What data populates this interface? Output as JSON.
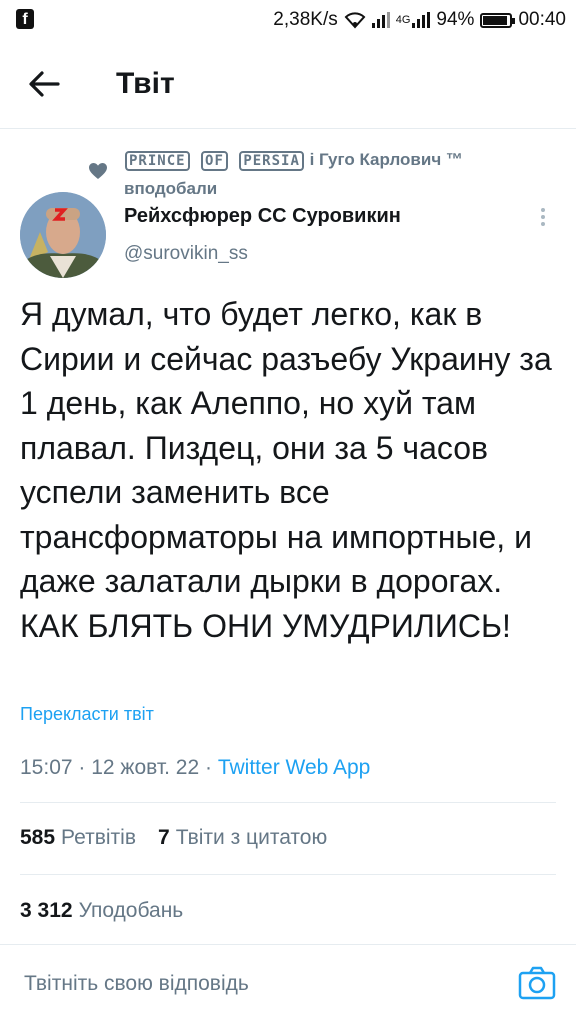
{
  "status_bar": {
    "network_speed": "2,38K/s",
    "network_type": "4G",
    "battery_percent": "94%",
    "battery_level": 0.94,
    "time": "00:40",
    "icons": [
      "facebook-icon",
      "wifi-icon",
      "signal-icon",
      "battery-icon"
    ]
  },
  "header": {
    "title": "Твіт",
    "back_icon": "arrow-left-icon"
  },
  "liked_context": {
    "name1_boxed_words": [
      "PRINCE",
      "OF",
      "PERSIA"
    ],
    "text_rest": " і Гуго Карлович ™ вподобали",
    "icon": "heart-icon"
  },
  "author": {
    "name": "Рейхсфюрер СС Суровикин",
    "handle": "@surovikin_ss"
  },
  "tweet": {
    "text": "Я думал, что будет легко, как в Сирии и сейчас разъебу Украину за 1 день, как Алеппо, но хуй там плавал. Пиздец, они за 5 часов успели заменить все трансформаторы на импортные, и даже залатали дырки в дорогах. КАК БЛЯТЬ ОНИ УМУДРИЛИСЬ!",
    "translate_label": "Перекласти твіт",
    "time": "15:07",
    "date": "12 жовт. 22",
    "source": "Twitter Web App",
    "sep": " · "
  },
  "stats": {
    "retweets_count": "585",
    "retweets_label": "Ретвітів",
    "quotes_count": "7",
    "quotes_label": "Твіти з цитатою",
    "likes_count": "3 312",
    "likes_label": "Уподобань"
  },
  "reply": {
    "placeholder": "Твітніть свою відповідь",
    "icon": "camera-icon"
  },
  "colors": {
    "accent": "#1da1f2",
    "muted": "#657786",
    "text": "#14171a",
    "divider": "#e6ecf0"
  }
}
